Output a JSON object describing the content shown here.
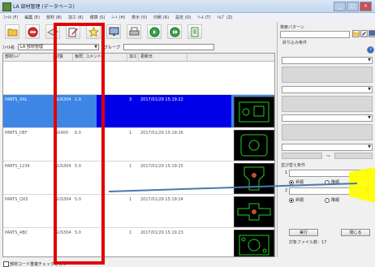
{
  "window": {
    "title": "LA 部材管理 (データベース)",
    "controls": [
      "_",
      "□",
      "×"
    ]
  },
  "menu": [
    "ﾌｧｲﾙ (F)",
    "編集 (E)",
    "部材 (B)",
    "加工 (K)",
    "積算 (S)",
    "ｼｰﾄ (H)",
    "表示 (V)",
    "印刷 (R)",
    "設定 (O)",
    "ﾂｰﾙ (T)",
    "ﾍﾙﾌﾟ (Z)"
  ],
  "toolbar": {
    "icons": [
      "folder-open-icon",
      "stop-icon",
      "eraser-icon",
      "edit-sheet-icon",
      "star-icon",
      "monitor-icon",
      "printer-icon",
      "forward-green-icon",
      "next-green-icon",
      "document-icon"
    ]
  },
  "filter": {
    "file_label": "ﾌｧｲﾙ名",
    "file_value": "LA 部材管理",
    "group_label": "グループ",
    "group_value": ""
  },
  "grid": {
    "columns": [
      "部材ｺｰﾄﾞ",
      "材質",
      "板厚",
      "コメント",
      "加工",
      "更新日"
    ],
    "rows": [
      {
        "code": "",
        "material": "",
        "thickness": "",
        "comment": "",
        "process": "",
        "date": "",
        "selected": false
      },
      {
        "code": "PARTS_XXL",
        "material": "SUS304",
        "thickness": "1.0",
        "comment": "",
        "process": "3",
        "date": "2017/01/29 15:19:22",
        "selected": true
      },
      {
        "code": "PARTS_DEF",
        "material": "SS400",
        "thickness": "6.0",
        "comment": "",
        "process": "1",
        "date": "2017/01/29 15:19:26",
        "selected": false
      },
      {
        "code": "PARTS_1234",
        "material": "SUS304",
        "thickness": "5.0",
        "comment": "",
        "process": "1",
        "date": "2017/01/29 15:19:25",
        "selected": false
      },
      {
        "code": "PARTS_QXS",
        "material": "SUS304",
        "thickness": "5.0",
        "comment": "",
        "process": "1",
        "date": "2017/01/29 15:19:24",
        "selected": false
      },
      {
        "code": "PARTS_ABC",
        "material": "SUS304",
        "thickness": "5.0",
        "comment": "",
        "process": "1",
        "date": "2017/01/29 15:19:23",
        "selected": false
      }
    ]
  },
  "panel": {
    "search_pattern_label": "検索パターン",
    "filter_conditions_label": "絞り込み条件",
    "sort_conditions_label": "並び替え条件",
    "sort_1": "1",
    "sort_2": "2",
    "ascending": "昇順",
    "descending": "降順",
    "execute_button": "実行",
    "close_button": "閉じる",
    "result_count": "対象ファイル数：17",
    "separator": "～"
  },
  "status": {
    "checkbox_label": "部材コード重複チェックを行う"
  }
}
